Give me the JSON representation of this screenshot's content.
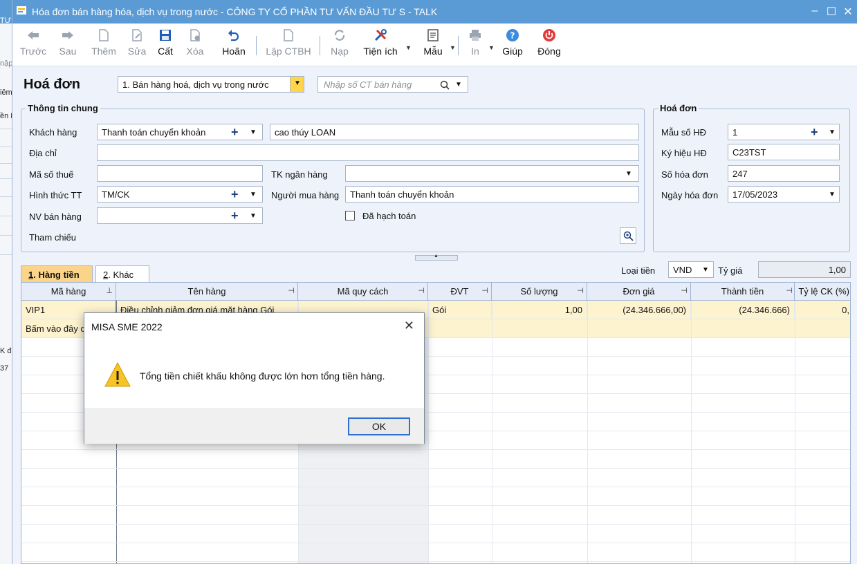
{
  "bg_window": {
    "texts": [
      "TƯ",
      "nập",
      "iêm",
      "ền K",
      "K đơ",
      "37"
    ]
  },
  "window": {
    "title": "Hóa đơn bán hàng hóa, dịch vụ trong nước - CÔNG TY CỔ PHẦN TƯ VẤN ĐẦU TƯ S - TALK",
    "minimize": "–",
    "maximize": "☐",
    "close": "✕"
  },
  "toolbar": {
    "truoc": "Trước",
    "sau": "Sau",
    "them": "Thêm",
    "sua": "Sửa",
    "cat": "Cất",
    "xoa": "Xóa",
    "hoan": "Hoãn",
    "lapctbh": "Lập CTBH",
    "nap": "Nạp",
    "tienich": "Tiện ích",
    "mau": "Mẫu",
    "in": "In",
    "giup": "Giúp",
    "dong": "Đóng"
  },
  "header": {
    "title": "Hoá đơn",
    "type_value": "1. Bán hàng hoá, dịch vụ trong nước",
    "search_placeholder": "Nhập số CT bán hàng"
  },
  "general": {
    "group_title": "Thông tin chung",
    "khach_hang_label": "Khách hàng",
    "khach_hang_value": "Thanh toán chuyển khoản",
    "khach_hang_name": "cao thúy LOAN",
    "dia_chi_label": "Địa chỉ",
    "dia_chi_value": "",
    "ma_so_thue_label": "Mã số thuế",
    "ma_so_thue_value": "",
    "tk_ngan_hang_label": "TK ngân hàng",
    "tk_ngan_hang_value": "",
    "hinh_thuc_tt_label": "Hình thức TT",
    "hinh_thuc_tt_value": "TM/CK",
    "nguoi_mua_label": "Người mua hàng",
    "nguoi_mua_value": "Thanh toán chuyển khoản",
    "nv_ban_hang_label": "NV bán hàng",
    "nv_ban_hang_value": "",
    "da_hach_toan_label": "Đã hạch toán",
    "tham_chieu_label": "Tham chiếu"
  },
  "invoice": {
    "group_title": "Hoá đơn",
    "mau_so_label": "Mẫu số HĐ",
    "mau_so_value": "1",
    "ky_hieu_label": "Ký hiệu HĐ",
    "ky_hieu_value": "C23TST",
    "so_hoa_don_label": "Số hóa đơn",
    "so_hoa_don_value": "247",
    "ngay_label": "Ngày hóa đơn",
    "ngay_value": "17/05/2023"
  },
  "tabs": {
    "hang_tien_num": "1",
    "hang_tien": ". Hàng tiền",
    "khac_num": "2",
    "khac": ". Khác"
  },
  "currency": {
    "loai_tien_label": "Loại tiền",
    "loai_tien_value": "VND",
    "ty_gia_label": "Tỷ giá",
    "ty_gia_value": "1,00"
  },
  "grid": {
    "columns": [
      "Mã hàng",
      "Tên hàng",
      "Mã quy cách",
      "ĐVT",
      "Số lượng",
      "Đơn giá",
      "Thành tiền",
      "Tỷ lệ CK (%)"
    ],
    "row": {
      "ma_hang": "VIP1",
      "ten_hang": "Điều chỉnh giảm đơn giá mặt hàng Gói",
      "dvt": "Gói",
      "so_luong": "1,00",
      "don_gia": "(24.346.666,00)",
      "thanh_tien": "(24.346.666)",
      "ty_le_ck": "0,"
    },
    "add_row_hint": "Bấm vào đây c"
  },
  "dialog": {
    "title": "MISA SME 2022",
    "close": "✕",
    "message": "Tổng tiền chiết khấu không được lớn hơn tổng tiền hàng.",
    "ok": "OK"
  },
  "colors": {
    "titlebar": "#5b9bd5",
    "tab_active": "#fbd48a",
    "row_highlight": "#fdf3cf",
    "accent_blue": "#1d3f7a"
  }
}
